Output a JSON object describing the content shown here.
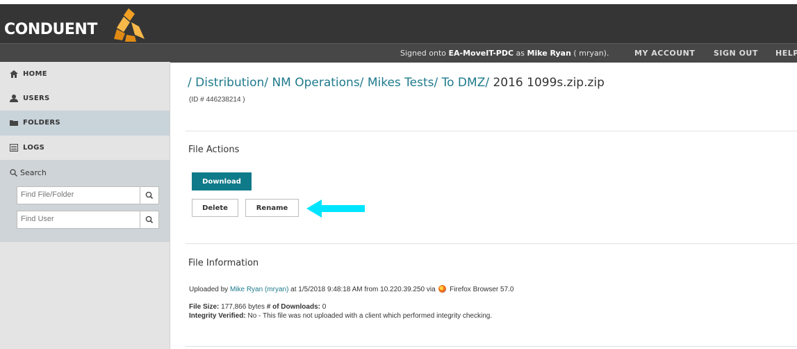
{
  "header": {
    "logo_text": "CONDUENT",
    "signed_prefix": "Signed onto ",
    "org": "EA-MoveIT-PDC",
    "as_text": " as ",
    "user_name": "Mike Ryan",
    "user_id": " ( mryan).",
    "nav": [
      "MY ACCOUNT",
      "SIGN OUT",
      "HELP"
    ]
  },
  "sidebar": {
    "items": [
      {
        "label": "HOME",
        "icon": "home-icon"
      },
      {
        "label": "USERS",
        "icon": "user-icon"
      },
      {
        "label": "FOLDERS",
        "icon": "folder-icon"
      },
      {
        "label": "LOGS",
        "icon": "logs-icon"
      }
    ],
    "search_title": "Search",
    "find_file_placeholder": "Find File/Folder",
    "find_user_placeholder": "Find User"
  },
  "breadcrumb": {
    "path": "/ Distribution/  NM Operations/  Mikes Tests/  To DMZ/ ",
    "file": "2016 1099s.zip.zip",
    "id_line": "(ID # 446238214 )"
  },
  "file_actions": {
    "title": "File Actions",
    "download": "Download",
    "delete": "Delete",
    "rename": "Rename"
  },
  "file_info": {
    "title": "File Information",
    "uploaded_by_prefix": "Uploaded by ",
    "uploader": "Mike Ryan (mryan)",
    "uploaded_mid": " at 1/5/2018 9:48:18 AM from 10.220.39.250 via ",
    "browser": " Firefox Browser 57.0",
    "file_size_label": "File Size:",
    "file_size_value": " 177,866 bytes ",
    "downloads_label": "  # of Downloads:",
    "downloads_value": " 0",
    "integrity_label": "Integrity Verified:",
    "integrity_value": " No - This file was not uploaded with a client which performed integrity checking."
  },
  "colors": {
    "accent": "#0f7a8a",
    "header_bg": "#353535",
    "arrow": "#00e5ff"
  }
}
